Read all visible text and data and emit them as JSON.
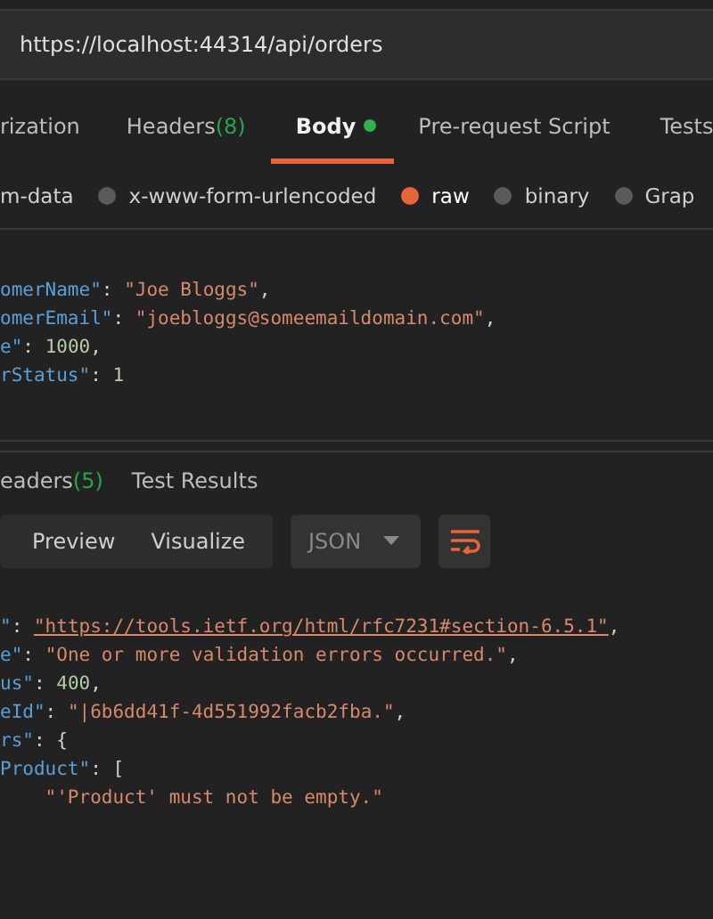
{
  "url_bar": {
    "value": "https://localhost:44314/api/orders"
  },
  "request_tabs": [
    {
      "label": "rization",
      "selected": false
    },
    {
      "label": "Headers",
      "count": "(8)",
      "selected": false
    },
    {
      "label": "Body",
      "dot": true,
      "selected": true
    },
    {
      "label": "Pre-request Script",
      "selected": false
    },
    {
      "label": "Tests",
      "selected": false
    }
  ],
  "body_types": [
    {
      "label": "m-data",
      "kind": "cut",
      "selected": false
    },
    {
      "label": "x-www-form-urlencoded",
      "kind": "radio",
      "selected": false
    },
    {
      "label": "raw",
      "kind": "radio",
      "selected": true
    },
    {
      "label": "binary",
      "kind": "radio",
      "selected": false
    },
    {
      "label": "Grap",
      "kind": "radio",
      "selected": false
    }
  ],
  "request_body": [
    [
      {
        "kind": "key",
        "text": "omerName\""
      },
      {
        "kind": "punct",
        "text": ": "
      },
      {
        "kind": "string",
        "text": "\"Joe Bloggs\""
      },
      {
        "kind": "punct",
        "text": ","
      }
    ],
    [
      {
        "kind": "key",
        "text": "omerEmail\""
      },
      {
        "kind": "punct",
        "text": ": "
      },
      {
        "kind": "string",
        "text": "\"joebloggs@someemaildomain.com\""
      },
      {
        "kind": "punct",
        "text": ","
      }
    ],
    [
      {
        "kind": "key",
        "text": "e\""
      },
      {
        "kind": "punct",
        "text": ": "
      },
      {
        "kind": "number",
        "text": "1000"
      },
      {
        "kind": "punct",
        "text": ","
      }
    ],
    [
      {
        "kind": "key",
        "text": "rStatus\""
      },
      {
        "kind": "punct",
        "text": ": "
      },
      {
        "kind": "number",
        "text": "1"
      }
    ]
  ],
  "response_tabs": [
    {
      "label": "eaders",
      "count": "(5)",
      "selected": false
    },
    {
      "label": "Test Results",
      "selected": false
    }
  ],
  "view_modes": [
    {
      "label": "Preview",
      "selected": false
    },
    {
      "label": "Visualize",
      "selected": false
    }
  ],
  "format_select": {
    "value": "JSON"
  },
  "response_body": [
    [
      {
        "kind": "key",
        "text": "\""
      },
      {
        "kind": "punct",
        "text": ": "
      },
      {
        "kind": "link",
        "text": "\"https://tools.ietf.org/html/rfc7231#section-6.5.1\""
      },
      {
        "kind": "punct",
        "text": ","
      }
    ],
    [
      {
        "kind": "key",
        "text": "e\""
      },
      {
        "kind": "punct",
        "text": ": "
      },
      {
        "kind": "string",
        "text": "\"One or more validation errors occurred.\""
      },
      {
        "kind": "punct",
        "text": ","
      }
    ],
    [
      {
        "kind": "key",
        "text": "us\""
      },
      {
        "kind": "punct",
        "text": ": "
      },
      {
        "kind": "number",
        "text": "400"
      },
      {
        "kind": "punct",
        "text": ","
      }
    ],
    [
      {
        "kind": "key",
        "text": "eId\""
      },
      {
        "kind": "punct",
        "text": ": "
      },
      {
        "kind": "string",
        "text": "\"|6b6dd41f-4d551992facb2fba.\""
      },
      {
        "kind": "punct",
        "text": ","
      }
    ],
    [
      {
        "kind": "key",
        "text": "rs\""
      },
      {
        "kind": "punct",
        "text": ": {"
      }
    ],
    [
      {
        "kind": "key",
        "text": "Product\""
      },
      {
        "kind": "punct",
        "text": ": ["
      }
    ],
    [
      {
        "kind": "indented_string",
        "text": "\"'Product' must not be empty.\""
      }
    ]
  ]
}
